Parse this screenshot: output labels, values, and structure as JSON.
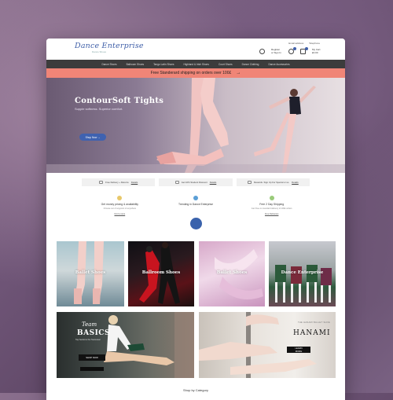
{
  "header": {
    "logo": "Dance Enterprise",
    "logo_sub": "Dance Shoes",
    "top_links": [
      "Email address",
      "Telephone"
    ],
    "account_label": "Register or Sign In",
    "cart_label": "My Cart £0.00"
  },
  "nav": {
    "items": [
      "Dance Shoes",
      "Ballroom Shoes",
      "Tango Latin Shoes",
      "Highland & Irish Shoes",
      "Court Shoes",
      "Dance Clothing",
      "Dance Accessories"
    ]
  },
  "promo": {
    "text": "Free Standerard shipping on orders over 100£",
    "arrow": "→"
  },
  "hero": {
    "title": "ContourSoft Tights",
    "subtitle": "Supple softness. Superior comfort.",
    "button": "Shop Now →"
  },
  "trust_bar": {
    "items": [
      {
        "label": "Free Delivery + Returns",
        "link": "Details"
      },
      {
        "label": "Get 10% Student Discount",
        "link": "Details"
      },
      {
        "label": "Rewards. Sign Up For Special or so.",
        "link": "Details"
      }
    ]
  },
  "features": [
    {
      "title": "Get money pricing & availability",
      "desc": "Choose out of anypoint of anywhere",
      "link": "Find a store",
      "color": "#e8c86a"
    },
    {
      "title": "Trending in Dance Enterprise",
      "desc": "",
      "link": "",
      "color": "#5b9fd6"
    },
    {
      "title": "Free 2 Day Shipping",
      "desc": "Get Free on standard delivery of 100£ orders",
      "link": "Free Deliveries",
      "color": "#9acb7a"
    }
  ],
  "tiles": {
    "t1": "Ballet Shoes",
    "t2": "Ballroom Shoes",
    "t3": "Ballet Shoes",
    "t4": "Dance Enterprise"
  },
  "banner_left": {
    "line1": "Team",
    "line2": "BASICS",
    "line3": "Tap Sections the Teamwear",
    "button": "SHOP NOW"
  },
  "banner_right": {
    "line1": "THE HANAMI BALLET SHOE",
    "line2": "HANAMI",
    "button": "LEARN MORE"
  },
  "footer": {
    "section_title": "Shop by Category"
  },
  "colors": {
    "brand": "#3f5fa8",
    "nav_bg": "#3c3c3c",
    "promo_bg": "#f08577"
  }
}
